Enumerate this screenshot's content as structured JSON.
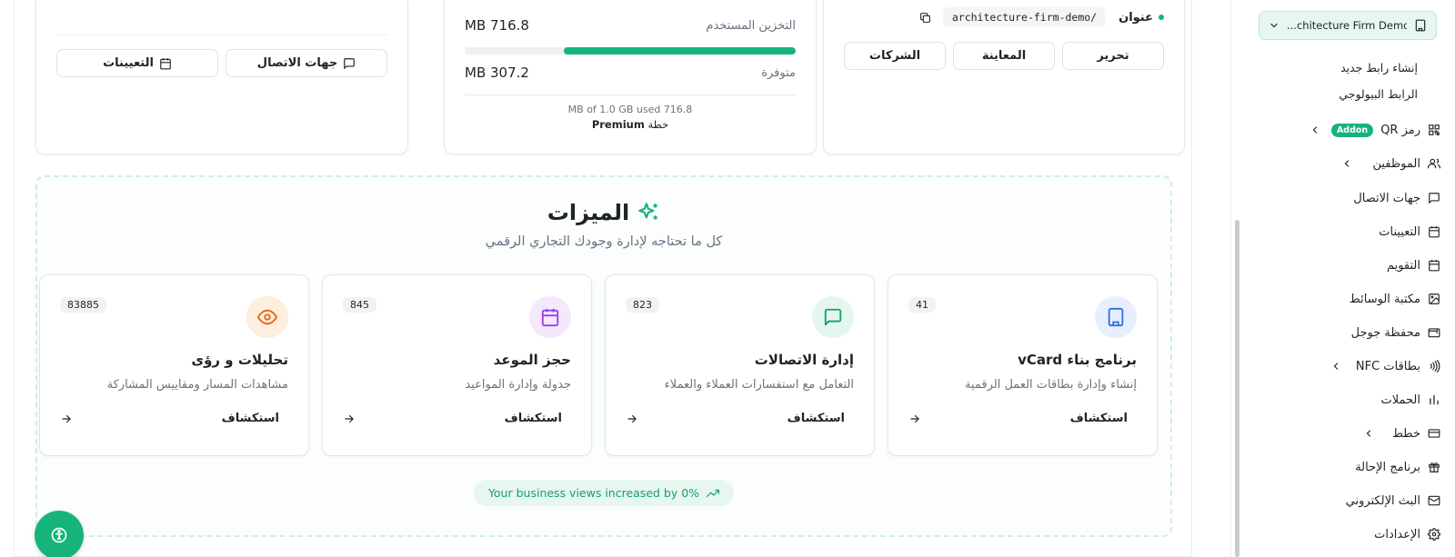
{
  "domain_card": {
    "label": "عنوان",
    "url": "architecture-firm-demo/",
    "buttons": [
      "تحرير",
      "المعاينة",
      "الشركات"
    ]
  },
  "storage_card": {
    "used_label": "التخزين المستخدم",
    "used_value": "MB 716.8",
    "available_label": "متوفرة",
    "available_value": "MB 307.2",
    "used_fraction": 0.7,
    "usage_text": "MB of 1.0 GB used 716.8",
    "plan_prefix": "خطة",
    "plan_name": "Premium"
  },
  "left_card": {
    "buttons": [
      "جهات الاتصال",
      "التعيينات"
    ]
  },
  "features": {
    "title": "الميزات",
    "subtitle": "كل ما تحتاجه لإدارة وجودك التجاري الرقمي",
    "cards": [
      {
        "title": "برنامج بناء vCard",
        "desc": "إنشاء وإدارة بطاقات العمل الرقمية",
        "count": "41",
        "link": "استكشاف",
        "icon": "building-icon",
        "color": "#2f6fe4",
        "bg": "#e7efff"
      },
      {
        "title": "إدارة الاتصالات",
        "desc": "التعامل مع استفسارات العملاء والعملاء",
        "count": "823",
        "link": "استكشاف",
        "icon": "message-icon",
        "color": "#16a06a",
        "bg": "#e3f7ee"
      },
      {
        "title": "حجز الموعد",
        "desc": "جدولة وإدارة المواعيد",
        "count": "845",
        "link": "استكشاف",
        "icon": "calendar-icon",
        "color": "#9b3fe0",
        "bg": "#f3e8fd"
      },
      {
        "title": "تحليلات و رؤى",
        "desc": "مشاهدات المسار ومقاييس المشاركة",
        "count": "83885",
        "link": "استكشاف",
        "icon": "eye-icon",
        "color": "#e8650a",
        "bg": "#fdeedd"
      }
    ],
    "trend": "Your business views increased by 0%"
  },
  "sidebar": {
    "org": "...chitecture Firm Demo",
    "sub_links": [
      "إنشاء رابط جديد",
      "الرابط البيولوجي"
    ],
    "items": [
      {
        "label": "رمز QR",
        "icon": "qr-icon",
        "badge": "Addon",
        "chevron": true
      },
      {
        "label": "الموظفين",
        "icon": "users-icon",
        "chevron": true
      },
      {
        "label": "جهات الاتصال",
        "icon": "message-icon"
      },
      {
        "label": "التعيينات",
        "icon": "calendar-icon"
      },
      {
        "label": "التقويم",
        "icon": "calendar-icon"
      },
      {
        "label": "مكتبة الوسائط",
        "icon": "image-icon"
      },
      {
        "label": "محفظة جوجل",
        "icon": "wallet-icon"
      },
      {
        "label": "بطاقات NFC",
        "icon": "nfc-icon",
        "chevron": true
      },
      {
        "label": "الحملات",
        "icon": "bar-chart-icon"
      },
      {
        "label": "خطط",
        "icon": "credit-card-icon",
        "chevron": true
      },
      {
        "label": "برنامج الإحالة",
        "icon": "gift-icon"
      },
      {
        "label": "البث الإلكتروني",
        "icon": "mail-icon"
      },
      {
        "label": "الإعدادات",
        "icon": "gear-icon"
      }
    ]
  }
}
